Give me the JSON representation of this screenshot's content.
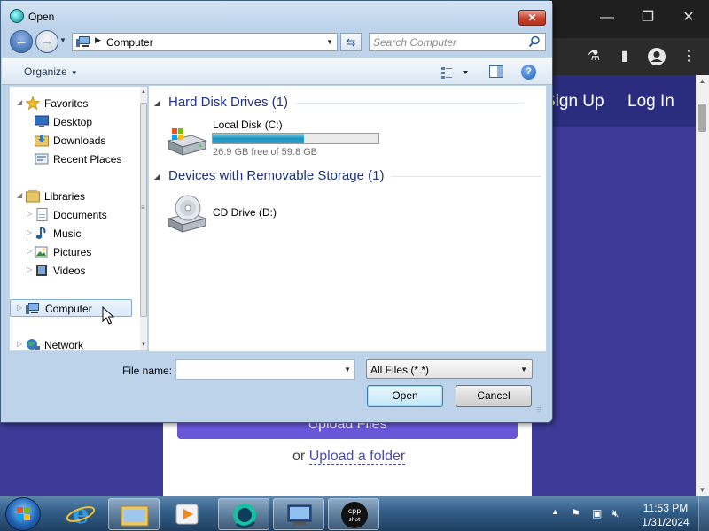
{
  "dialog": {
    "title": "Open",
    "close_glyph": "✕",
    "address": {
      "location": "Computer"
    },
    "search": {
      "placeholder": "Search Computer"
    },
    "toolbar": {
      "organize_label": "Organize"
    },
    "nav_pane": {
      "favorites": {
        "label": "Favorites",
        "items": [
          "Desktop",
          "Downloads",
          "Recent Places"
        ]
      },
      "libraries": {
        "label": "Libraries",
        "items": [
          "Documents",
          "Music",
          "Pictures",
          "Videos"
        ]
      },
      "computer": "Computer",
      "network": "Network"
    },
    "content": {
      "groups": [
        {
          "title": "Hard Disk Drives (1)",
          "drives": [
            {
              "name": "Local Disk (C:)",
              "free_text": "26.9 GB free of 59.8 GB",
              "used_fraction": 0.55
            }
          ]
        },
        {
          "title": "Devices with Removable Storage (1)",
          "drives": [
            {
              "name": "CD Drive (D:)"
            }
          ]
        }
      ]
    },
    "footer": {
      "filename_label": "File name:",
      "filename_value": "",
      "filter_value": "All Files (*.*)",
      "open_label": "Open",
      "cancel_label": "Cancel"
    },
    "icons": {
      "back": "back-arrow-icon",
      "forward": "forward-arrow-icon",
      "refresh": "refresh-icon",
      "search": "search-icon",
      "help": "help-icon"
    }
  },
  "browser": {
    "nav_links": [
      "Sign Up",
      "Log In"
    ],
    "upload_files_label": "Upload Files",
    "or_text": "or",
    "upload_folder_label": "Upload a folder",
    "colors": {
      "page_bg": "#3d3a97",
      "header_bg": "#2a2d7d",
      "button": "#6a57d8"
    }
  },
  "taskbar": {
    "time": "11:53 PM",
    "date": "1/31/2024",
    "apps": [
      "Internet Explorer",
      "Windows Explorer",
      "Media Player",
      "Browser",
      "Remote Desktop",
      "cpp shot"
    ]
  }
}
